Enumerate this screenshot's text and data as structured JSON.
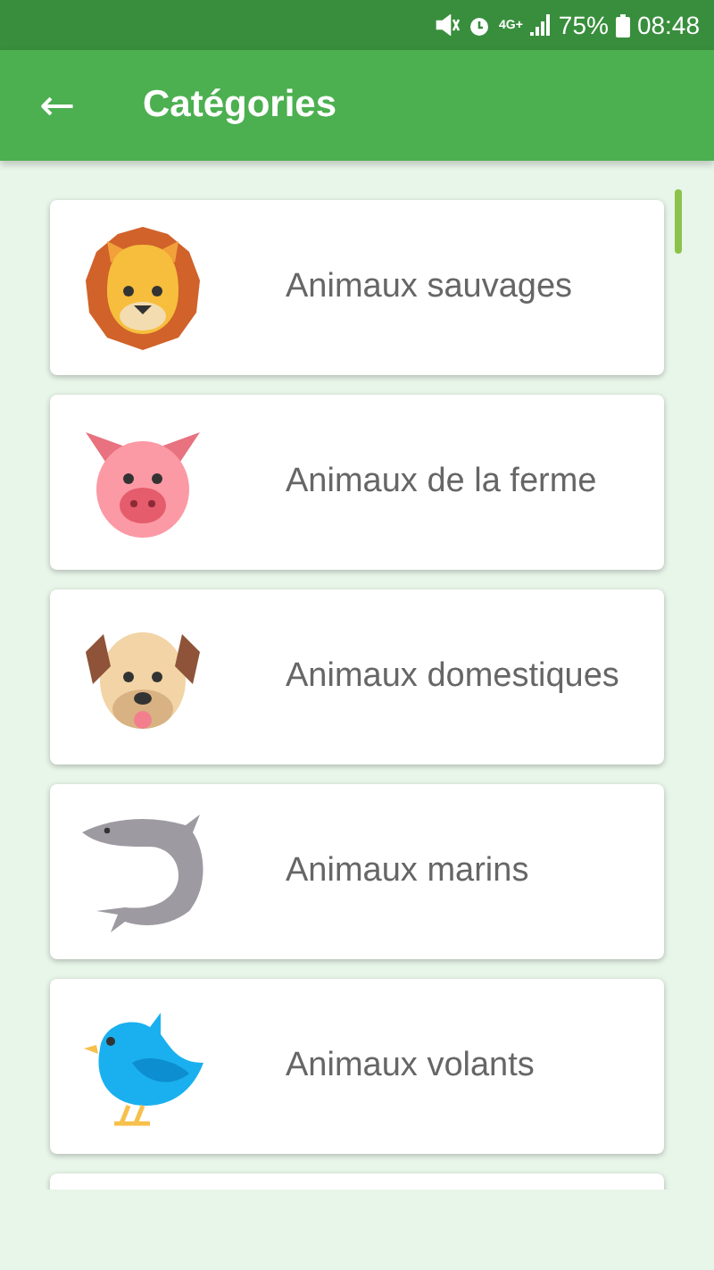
{
  "status_bar": {
    "network": "4G+",
    "battery": "75%",
    "time": "08:48"
  },
  "app_bar": {
    "back": "←",
    "title": "Catégories"
  },
  "categories": [
    {
      "label": "Animaux sauvages",
      "kind": "lion"
    },
    {
      "label": "Animaux de la ferme",
      "kind": "pig"
    },
    {
      "label": "Animaux domestiques",
      "kind": "dog"
    },
    {
      "label": "Animaux marins",
      "kind": "shark"
    },
    {
      "label": "Animaux volants",
      "kind": "bird"
    }
  ],
  "more_below": true
}
